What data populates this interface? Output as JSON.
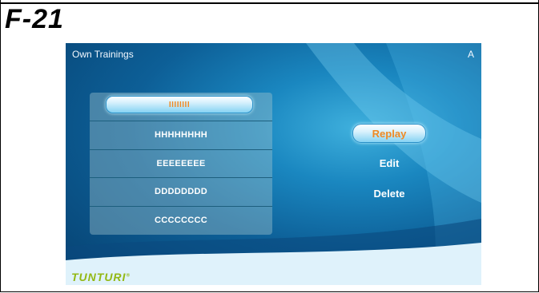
{
  "figure_label": "F-21",
  "screen": {
    "title": "Own Trainings",
    "corner_label": "A"
  },
  "trainings": [
    "IIIIIIII",
    "HHHHHHHH",
    "EEEEEEEE",
    "DDDDDDDD",
    "CCCCCCCC"
  ],
  "selected_index": 0,
  "actions": {
    "replay": "Replay",
    "edit": "Edit",
    "delete": "Delete"
  },
  "brand": {
    "logo": "TUNTURI",
    "registered": "®"
  },
  "colors": {
    "highlight_text": "#f08a24",
    "brand_green": "#93b813",
    "screen_dark": "#06406f",
    "screen_light": "#3fb0dd"
  }
}
